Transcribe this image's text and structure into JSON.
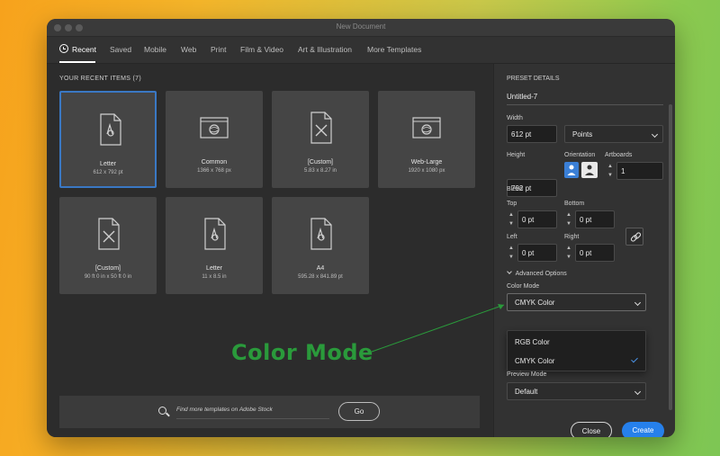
{
  "window": {
    "title": "New Document"
  },
  "tabs": [
    {
      "label": "Recent"
    },
    {
      "label": "Saved"
    },
    {
      "label": "Mobile"
    },
    {
      "label": "Web"
    },
    {
      "label": "Print"
    },
    {
      "label": "Film & Video"
    },
    {
      "label": "Art & Illustration"
    },
    {
      "label": "More Templates"
    }
  ],
  "recent": {
    "heading": "YOUR RECENT ITEMS",
    "count": "(7)",
    "items": [
      {
        "name": "Letter",
        "size": "612 x 792 pt",
        "icon": "print-document-icon"
      },
      {
        "name": "Common",
        "size": "1366 x 768 px",
        "icon": "web-document-icon"
      },
      {
        "name": "[Custom]",
        "size": "5.83 x 8.27 in",
        "icon": "art-document-icon"
      },
      {
        "name": "Web-Large",
        "size": "1920 x 1080 px",
        "icon": "web-document-icon"
      },
      {
        "name": "[Custom]",
        "size": "90 ft 0 in x 50 ft 0 in",
        "icon": "art-document-icon"
      },
      {
        "name": "Letter",
        "size": "11 x 8.5 in",
        "icon": "print-document-icon"
      },
      {
        "name": "A4",
        "size": "595.28 x 841.89 pt",
        "icon": "print-document-icon"
      }
    ]
  },
  "search": {
    "placeholder": "Find more templates on Adobe Stock",
    "go_label": "Go"
  },
  "preset": {
    "heading": "PRESET DETAILS",
    "name": "Untitled-7",
    "width_label": "Width",
    "width_value": "612 pt",
    "units_value": "Points",
    "height_label": "Height",
    "height_value": "792 pt",
    "orientation_label": "Orientation",
    "artboards_label": "Artboards",
    "artboards_value": "1",
    "bleed_label": "Bleed",
    "top_label": "Top",
    "top_value": "0 pt",
    "bottom_label": "Bottom",
    "bottom_value": "0 pt",
    "left_label": "Left",
    "left_value": "0 pt",
    "right_label": "Right",
    "right_value": "0 pt",
    "advanced_label": "Advanced Options",
    "color_mode_label": "Color Mode",
    "color_mode_value": "CMYK Color",
    "color_mode_options": [
      "RGB Color",
      "CMYK Color"
    ],
    "preview_mode_label": "Preview Mode",
    "preview_mode_value": "Default"
  },
  "actions": {
    "close_label": "Close",
    "create_label": "Create"
  },
  "annotation": {
    "text": "Color Mode"
  },
  "colors": {
    "accent": "#2680eb",
    "annotation": "#2a9a3b",
    "selection": "#3a78c4"
  }
}
